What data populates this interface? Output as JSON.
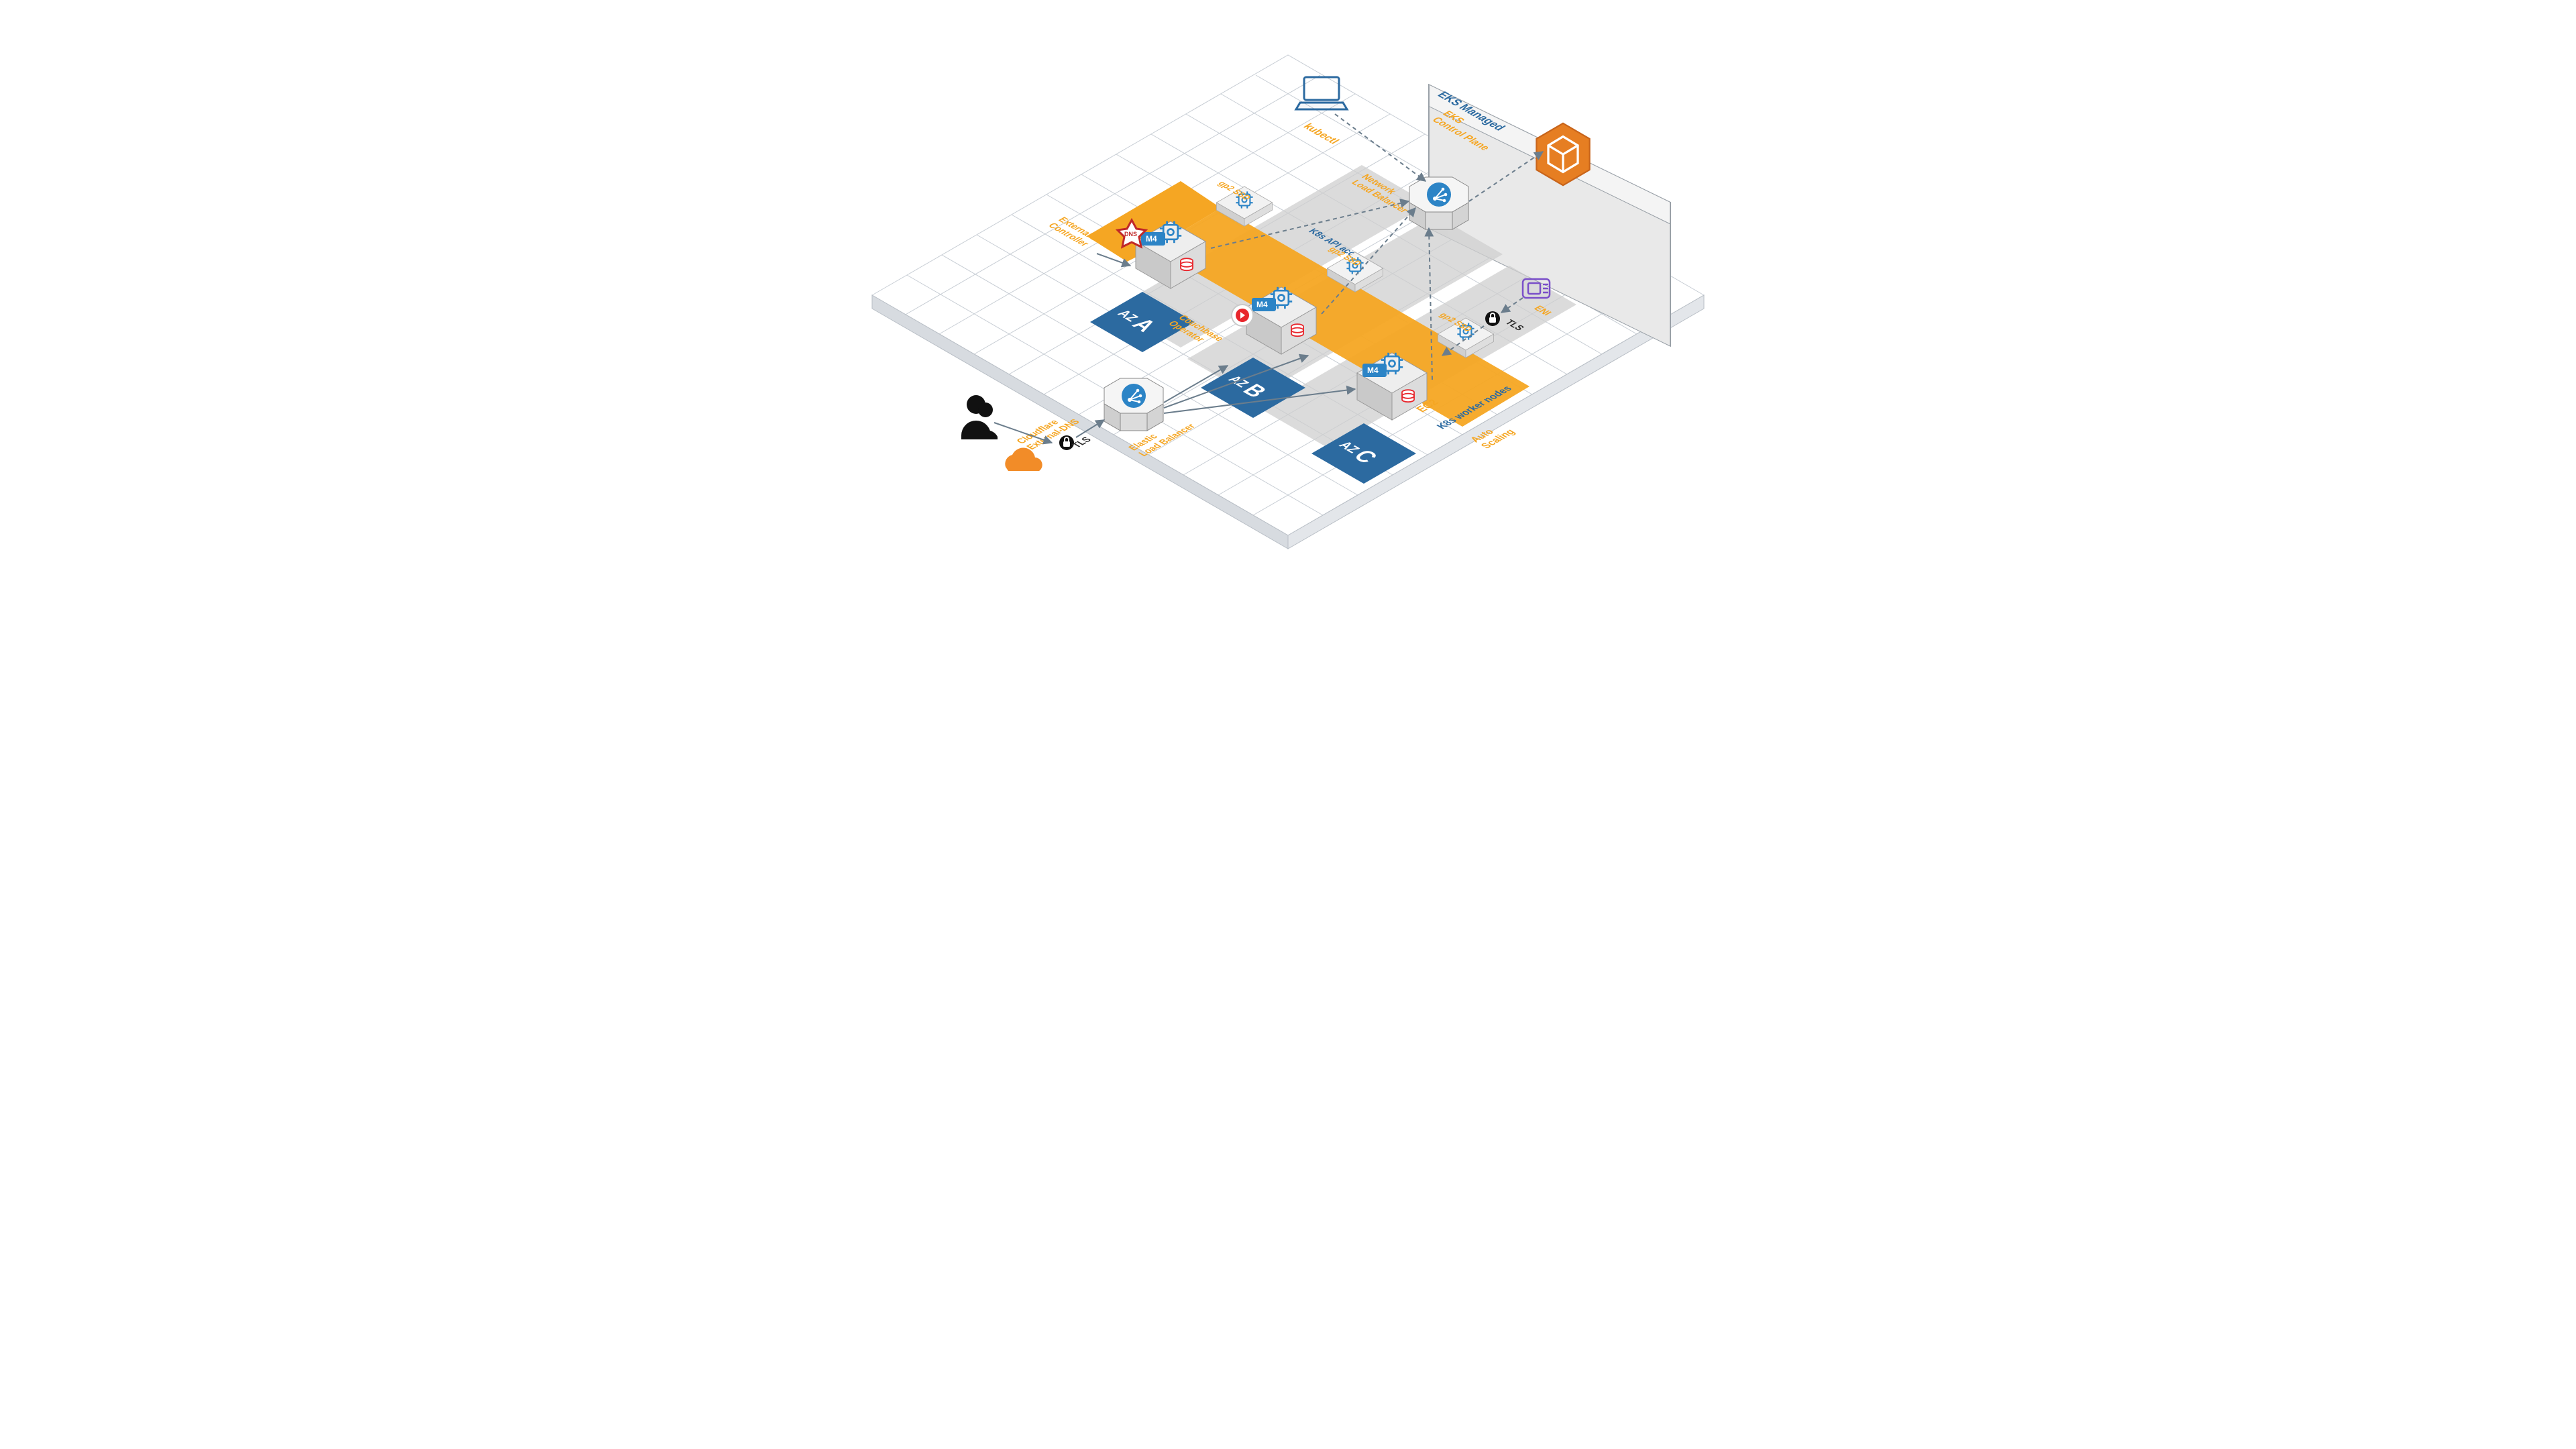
{
  "labels": {
    "kubectl": "kubectl",
    "eks_managed": "EKS Managed",
    "eks_cp": "EKS\nControl Plane",
    "nlb": "Network\nLoad Balancer",
    "k8s_api": "K8s API access",
    "ext_dns": "External DNS\nController",
    "couchbase": "Couchbase\nOperator",
    "gp2": "gp2 SSD",
    "m4": "M4",
    "ec2": "EC2",
    "k8s_workers": "K8s worker nodes",
    "autoscaling": "Auto\nScaling",
    "eni": "ENI",
    "tls": "TLS",
    "cloudflare": "Cloudflare\nExternal-DNS",
    "elb": "Elastic\nLoad Balancer",
    "az": "AZ",
    "aza": "A",
    "azb": "B",
    "azc": "C"
  },
  "colors": {
    "orange": "#f5a623",
    "blue": "#2c6aa0",
    "lightgray": "#d8d8d8",
    "midgray": "#bfbfbf",
    "darkgray": "#7a7a7a",
    "red": "#e8262c",
    "purple": "#7a4fc9",
    "cloud": "#f28c28"
  },
  "chart_data": {
    "type": "diagram",
    "description": "Isometric AWS/EKS architecture",
    "boundaries": [
      "VPC (grid floor)",
      "EKS Managed panel"
    ],
    "availability_zones": [
      "AZ A",
      "AZ B",
      "AZ C"
    ],
    "per_az_components": [
      "EC2 M4 worker node",
      "gp2 SSD EBS volume"
    ],
    "shared_components": [
      "kubectl (laptop)",
      "EKS Control Plane",
      "Network Load Balancer (K8s API access)",
      "External-DNS Controller",
      "Couchbase Operator",
      "K8s worker nodes Auto Scaling band",
      "ENI",
      "TLS lock (2)",
      "Cloudflare External-DNS",
      "Elastic Load Balancer",
      "User"
    ],
    "flows": [
      "User → TLS → Cloudflare External-DNS → Elastic Load Balancer → AZ A/B/C worker nodes",
      "kubectl → Network Load Balancer → EKS Control Plane",
      "Worker nodes (K8s API access) → Network Load Balancer",
      "External-DNS Controller → AZ A worker",
      "ENI ↔ TLS ↔ worker nodes"
    ]
  }
}
